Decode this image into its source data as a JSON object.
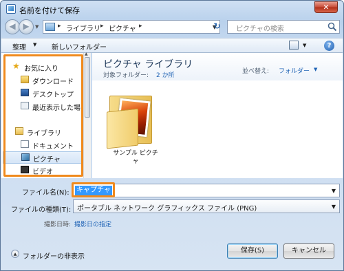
{
  "window": {
    "title": "名前を付けて保存",
    "close_glyph": "✕"
  },
  "nav": {
    "back_glyph": "◀",
    "forward_glyph": "▶",
    "address_segments": [
      "ライブラリ",
      "ピクチャ"
    ],
    "separator": "▸",
    "refresh_glyph": "↻",
    "search_placeholder": "ピクチャの検索"
  },
  "toolbar": {
    "organize_label": "整理",
    "new_folder_label": "新しいフォルダー",
    "help_glyph": "?"
  },
  "sidebar": {
    "favorites": {
      "label": "お気に入り",
      "icon": "star-icon"
    },
    "favorite_items": [
      {
        "label": "ダウンロード",
        "icon": "download-icon"
      },
      {
        "label": "デスクトップ",
        "icon": "desktop-icon"
      },
      {
        "label": "最近表示した場",
        "icon": "recent-places-icon"
      }
    ],
    "libraries": {
      "label": "ライブラリ",
      "icon": "library-icon"
    },
    "library_items": [
      {
        "label": "ドキュメント",
        "icon": "documents-icon"
      },
      {
        "label": "ピクチャ",
        "icon": "pictures-icon",
        "selected": true
      },
      {
        "label": "ビデオ",
        "icon": "video-icon"
      }
    ]
  },
  "content": {
    "library_title": "ピクチャ ライブラリ",
    "target_label": "対象フォルダー:",
    "target_value": "2 か所",
    "sort_label": "並べ替え:",
    "sort_value": "フォルダー",
    "items": [
      {
        "name_line1": "サンプル ピクチ",
        "name_line2": "ャ"
      }
    ]
  },
  "form": {
    "filename_label": "ファイル名(N):",
    "filename_value": "キャプチャ",
    "filetype_label": "ファイルの種類(T):",
    "filetype_value": "ポータブル ネットワーク グラフィックス ファイル (PNG)",
    "date_label": "撮影日時:",
    "date_link": "撮影日の指定",
    "hide_folders_label": "フォルダーの非表示",
    "save_label": "保存(S)",
    "cancel_label": "キャンセル"
  },
  "colors": {
    "highlight": "#f08a1d",
    "selection": "#3399ff",
    "link": "#1f63b5"
  }
}
